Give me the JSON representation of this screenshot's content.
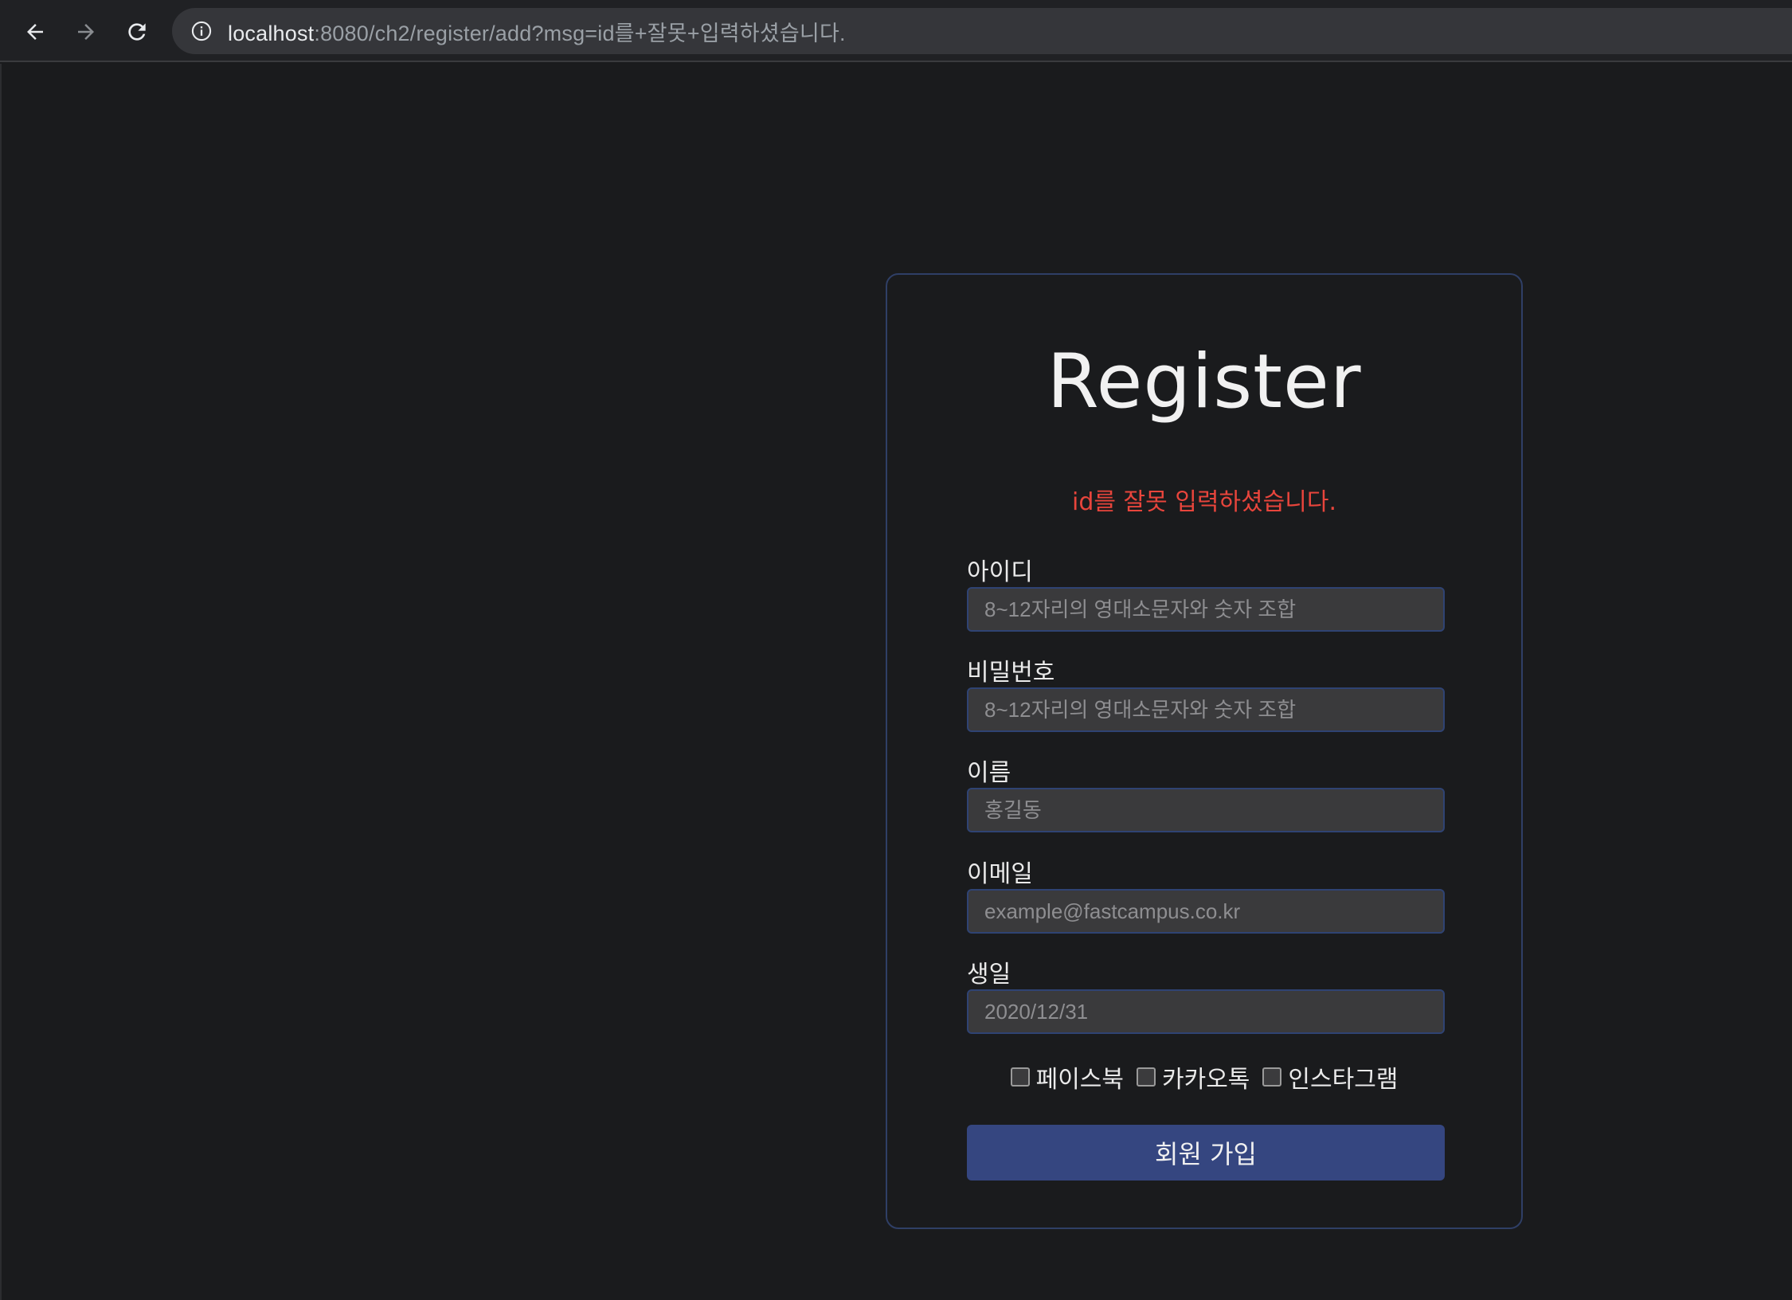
{
  "browser": {
    "url_host": "localhost",
    "url_rest": ":8080/ch2/register/add?msg=id를+잘못+입력하셨습니다."
  },
  "form": {
    "title": "Register",
    "error_message": "id를 잘못 입력하셨습니다.",
    "fields": [
      {
        "label": "아이디",
        "placeholder": "8~12자리의 영대소문자와 숫자 조합"
      },
      {
        "label": "비밀번호",
        "placeholder": "8~12자리의 영대소문자와 숫자 조합"
      },
      {
        "label": "이름",
        "placeholder": "홍길동"
      },
      {
        "label": "이메일",
        "placeholder": "example@fastcampus.co.kr"
      },
      {
        "label": "생일",
        "placeholder": "2020/12/31"
      }
    ],
    "sns": [
      {
        "label": "페이스북",
        "checked": false
      },
      {
        "label": "카카오톡",
        "checked": false
      },
      {
        "label": "인스타그램",
        "checked": false
      }
    ],
    "submit_label": "회원 가입"
  },
  "colors": {
    "background": "#1a1b1d",
    "card_border": "#2f3f66",
    "error": "#e8453c",
    "button": "#354680",
    "input_bg": "#3a3a3c"
  },
  "icons": {
    "back": "arrow-left-icon",
    "forward": "arrow-right-icon",
    "reload": "reload-icon",
    "site_info": "info-icon"
  }
}
